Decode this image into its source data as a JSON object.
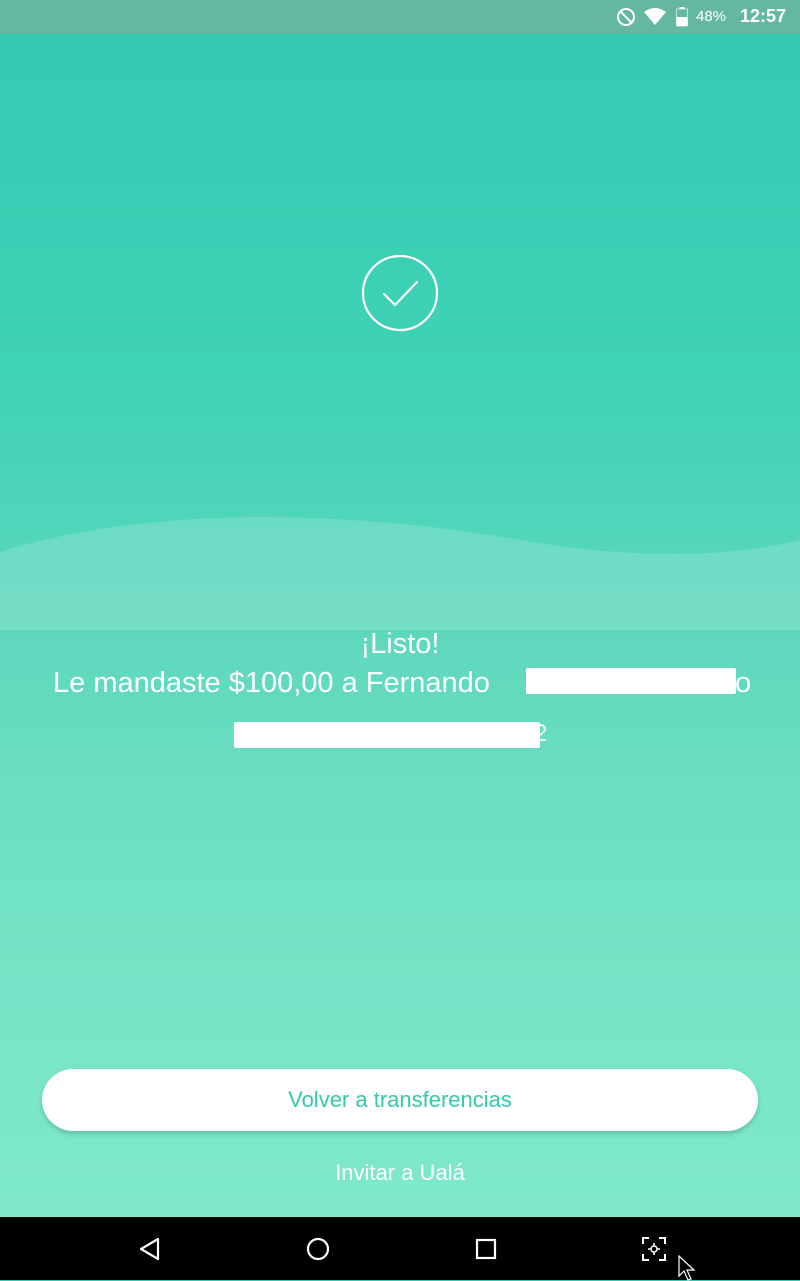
{
  "status_bar": {
    "battery_percent": "48%",
    "time": "12:57",
    "icons": [
      "do-not-disturb-icon",
      "wifi-icon",
      "battery-icon"
    ]
  },
  "success": {
    "icon": "checkmark-circle-icon",
    "title": "¡Listo!",
    "message": "Le mandaste $100,00 a Fernando",
    "redacted_tail_1": "o",
    "redacted_tail_2": "2"
  },
  "actions": {
    "primary_label": "Volver a transferencias",
    "secondary_label": "Invitar a Ualá"
  },
  "nav_bar": {
    "icons": [
      "back-icon",
      "home-icon",
      "recents-icon",
      "screenshot-icon"
    ]
  },
  "colors": {
    "gradient_top": "#33c9b0",
    "gradient_bottom": "#80ebcb",
    "accent": "#34c9a8",
    "status_bar": "#64b89f"
  }
}
